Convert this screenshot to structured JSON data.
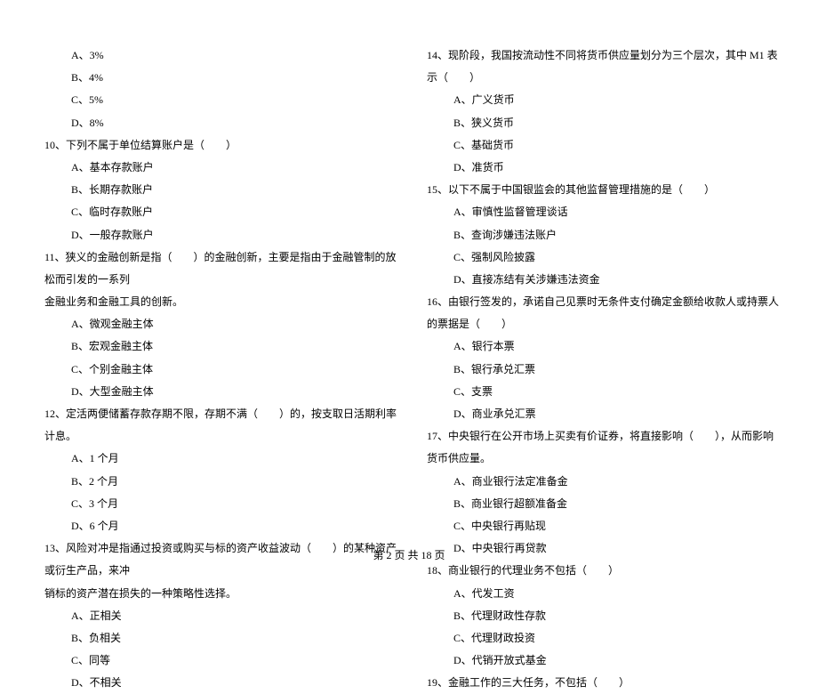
{
  "left": {
    "opts9": [
      "A、3%",
      "B、4%",
      "C、5%",
      "D、8%"
    ],
    "q10": "10、下列不属于单位结算账户是（　　）",
    "opts10": [
      "A、基本存款账户",
      "B、长期存款账户",
      "C、临时存款账户",
      "D、一般存款账户"
    ],
    "q11a": "11、狭义的金融创新是指（　　）的金融创新，主要是指由于金融管制的放松而引发的一系列",
    "q11b": "金融业务和金融工具的创新。",
    "opts11": [
      "A、微观金融主体",
      "B、宏观金融主体",
      "C、个别金融主体",
      "D、大型金融主体"
    ],
    "q12": "12、定活两便储蓄存款存期不限，存期不满（　　）的，按支取日活期利率计息。",
    "opts12": [
      "A、1 个月",
      "B、2 个月",
      "C、3 个月",
      "D、6 个月"
    ],
    "q13a": "13、风险对冲是指通过投资或购买与标的资产收益波动（　　）的某种资产或衍生产品，来冲",
    "q13b": "销标的资产潜在损失的一种策略性选择。",
    "opts13": [
      "A、正相关",
      "B、负相关",
      "C、同等",
      "D、不相关"
    ]
  },
  "right": {
    "q14": "14、现阶段，我国按流动性不同将货币供应量划分为三个层次，其中 M1 表示（　　）",
    "opts14": [
      "A、广义货币",
      "B、狭义货币",
      "C、基础货币",
      "D、准货币"
    ],
    "q15": "15、以下不属于中国银监会的其他监督管理措施的是（　　）",
    "opts15": [
      "A、审慎性监督管理谈话",
      "B、查询涉嫌违法账户",
      "C、强制风险披露",
      "D、直接冻结有关涉嫌违法资金"
    ],
    "q16": "16、由银行签发的，承诺自己见票时无条件支付确定金额给收款人或持票人的票据是（　　）",
    "opts16": [
      "A、银行本票",
      "B、银行承兑汇票",
      "C、支票",
      "D、商业承兑汇票"
    ],
    "q17": "17、中央银行在公开市场上买卖有价证券，将直接影响（　　），从而影响货币供应量。",
    "opts17": [
      "A、商业银行法定准备金",
      "B、商业银行超额准备金",
      "C、中央银行再贴现",
      "D、中央银行再贷款"
    ],
    "q18": "18、商业银行的代理业务不包括（　　）",
    "opts18": [
      "A、代发工资",
      "B、代理财政性存款",
      "C、代理财政投资",
      "D、代销开放式基金"
    ],
    "q19": "19、金融工作的三大任务，不包括（　　）"
  },
  "footer": "第 2 页 共 18 页"
}
